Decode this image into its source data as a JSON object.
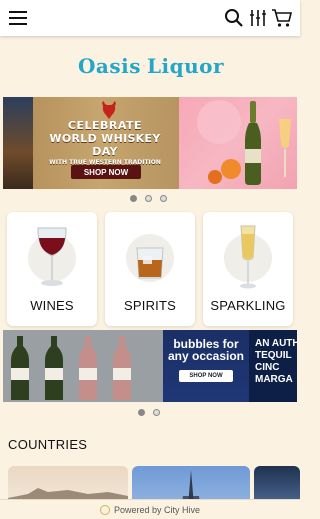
{
  "header": {
    "menu_icon": "hamburger-menu-icon",
    "search_icon": "search-icon",
    "filters_icon": "utensils-icon",
    "cart_icon": "cart-icon"
  },
  "brand": {
    "word1": "Oasis",
    "word2": "Liquor",
    "color": "#23a6c7",
    "palm_color": "#e0262b"
  },
  "hero_banner": {
    "line1": "CELEBRATE",
    "line2": "WORLD WHISKEY DAY",
    "line3": "WITH TRUE WESTERN TRADITION",
    "button": "SHOP NOW",
    "dots_total": 3,
    "active_index": 0
  },
  "categories": [
    {
      "label": "WINES"
    },
    {
      "label": "SPIRITS"
    },
    {
      "label": "SPARKLING"
    }
  ],
  "promo_banner": {
    "headline_1": "bubbles for",
    "headline_2": "any occasion",
    "button": "SHOP NOW",
    "side_line1": "AN AUTH",
    "side_line2": "TEQUIL",
    "side_line3": "CINC",
    "side_line4": "MARGA",
    "dots_total": 2,
    "active_index": 0
  },
  "countries": {
    "title": "COUNTRIES"
  },
  "footer": {
    "text": "Powered by City Hive"
  }
}
